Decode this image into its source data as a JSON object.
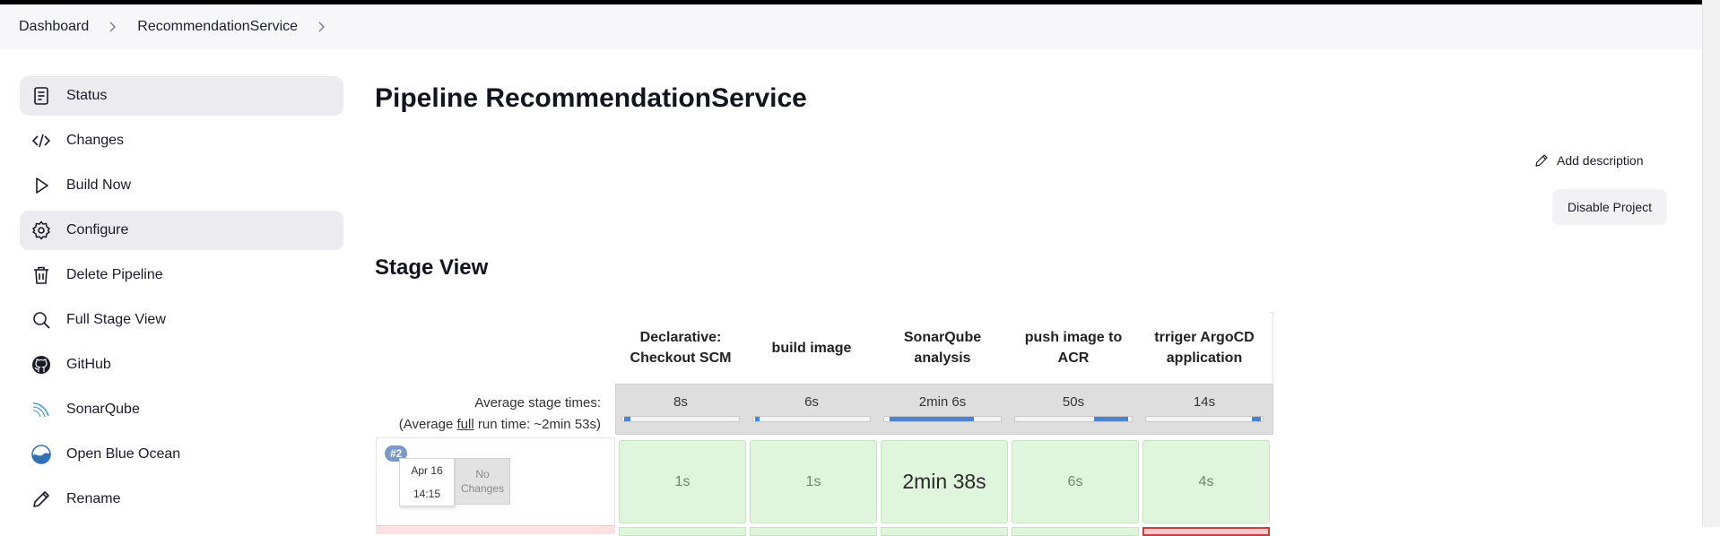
{
  "breadcrumb": {
    "items": [
      "Dashboard",
      "RecommendationService"
    ]
  },
  "sidebar": {
    "items": [
      {
        "label": "Status",
        "icon": "status-icon"
      },
      {
        "label": "Changes",
        "icon": "code-icon"
      },
      {
        "label": "Build Now",
        "icon": "play-icon"
      },
      {
        "label": "Configure",
        "icon": "gear-icon"
      },
      {
        "label": "Delete Pipeline",
        "icon": "trash-icon"
      },
      {
        "label": "Full Stage View",
        "icon": "search-icon"
      },
      {
        "label": "GitHub",
        "icon": "github-icon"
      },
      {
        "label": "SonarQube",
        "icon": "sonarqube-icon"
      },
      {
        "label": "Open Blue Ocean",
        "icon": "blue-ocean-icon"
      },
      {
        "label": "Rename",
        "icon": "pencil-icon"
      }
    ]
  },
  "main": {
    "title": "Pipeline RecommendationService",
    "add_description": "Add description",
    "disable_project": "Disable Project",
    "stage_view_title": "Stage View"
  },
  "stage_view": {
    "average_label": "Average stage times:",
    "full_run_prefix": "(Average ",
    "full_run_link": "full",
    "full_run_suffix": " run time: ~2min 53s)",
    "stages": [
      {
        "name": "Declarative: Checkout SCM",
        "avg": "8s",
        "avg_fraction": 0.05
      },
      {
        "name": "build image",
        "avg": "6s",
        "avg_fraction": 0.04
      },
      {
        "name": "SonarQube analysis",
        "avg": "2min 6s",
        "avg_fraction": 0.72
      },
      {
        "name": "push image to ACR",
        "avg": "50s",
        "avg_fraction": 0.29
      },
      {
        "name": "trriger ArgoCD application",
        "avg": "14s",
        "avg_fraction": 0.08
      }
    ],
    "runs": [
      {
        "badge": "#2",
        "date": "Apr 16",
        "time": "14:15",
        "changes": "No Changes",
        "durations": [
          "1s",
          "1s",
          "2min 38s",
          "6s",
          "4s"
        ]
      }
    ]
  },
  "colors": {
    "success_cell": "#dff5dc",
    "failed_cell": "#f4caca",
    "progress_fill": "#4a84d0",
    "active_sidebar": "#ececf0"
  }
}
